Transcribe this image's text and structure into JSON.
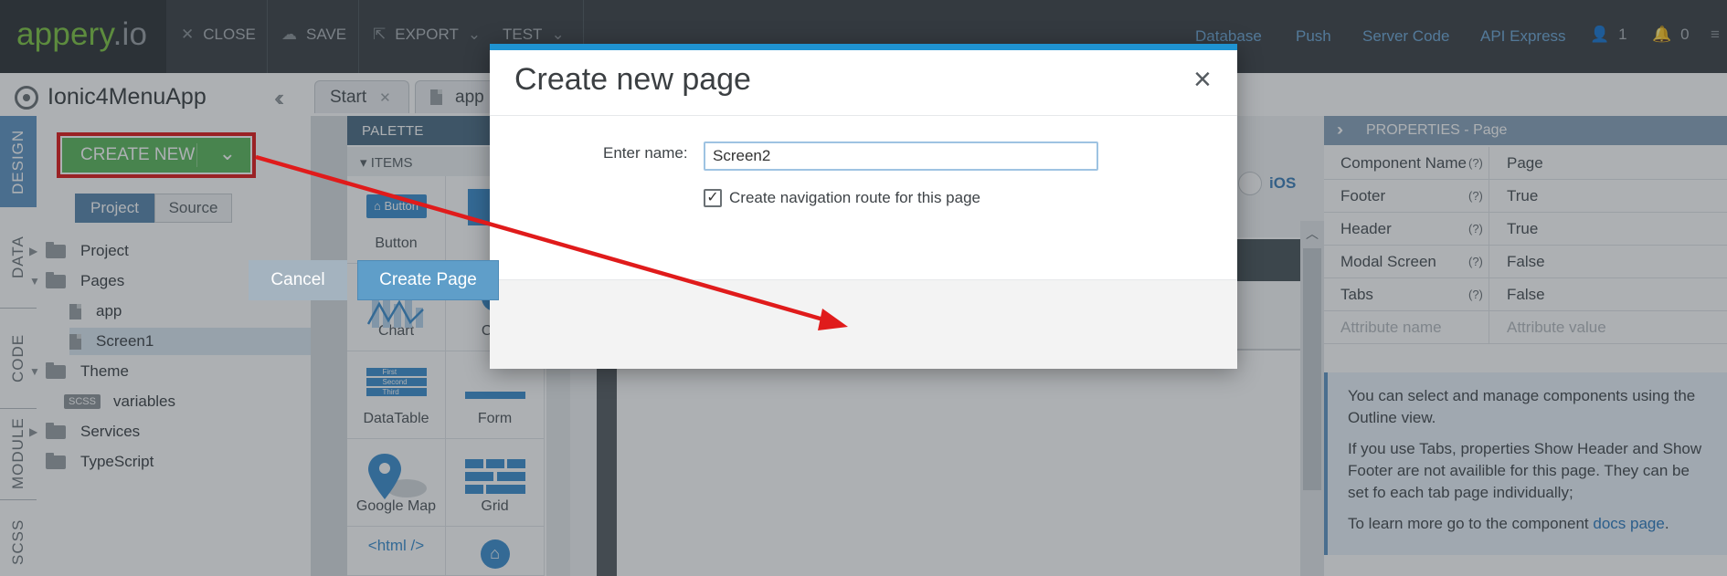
{
  "topbar": {
    "logo_main": "appery",
    "logo_suffix": ".io",
    "close_label": "CLOSE",
    "save_label": "SAVE",
    "export_label": "EXPORT",
    "test_label": "TEST",
    "database_label": "Database",
    "push_label": "Push",
    "server_code_label": "Server Code",
    "api_express_label": "API Express",
    "user_count": "1",
    "notification_count": "0"
  },
  "project": {
    "title": "Ionic4MenuApp",
    "create_new_label": "CREATE NEW",
    "view_project_label": "Project",
    "view_source_label": "Source",
    "tree": [
      {
        "label": "Project",
        "type": "folder",
        "expandable": true
      },
      {
        "label": "Pages",
        "type": "folder",
        "expanded": true
      },
      {
        "label": "app",
        "type": "file"
      },
      {
        "label": "Screen1",
        "type": "file",
        "selected": true
      },
      {
        "label": "Theme",
        "type": "folder",
        "expanded": true
      },
      {
        "label": "variables",
        "type": "scss",
        "badge": "SCSS"
      },
      {
        "label": "Services",
        "type": "folder",
        "expandable": true
      },
      {
        "label": "TypeScript",
        "type": "folder"
      }
    ]
  },
  "editor_tabs": [
    {
      "label": "Start"
    },
    {
      "label": "app"
    }
  ],
  "side_tabs": [
    "DESIGN",
    "DATA",
    "CODE",
    "MODULE",
    "SCSS"
  ],
  "palette": {
    "title": "PALETTE",
    "section": "ITEMS",
    "button_art_label": "Button",
    "items": [
      "Button",
      "C",
      "Chart",
      "Che",
      "DataTable",
      "Form",
      "Google Map",
      "Grid",
      "<html />",
      ""
    ],
    "datatable_art_rows": [
      "First",
      "Second",
      "Third"
    ]
  },
  "canvas": {
    "platform_label": "iOS"
  },
  "properties": {
    "title": "PROPERTIES - Page",
    "help_marker": "(?)",
    "rows": [
      {
        "name": "Component Name",
        "value": "Page"
      },
      {
        "name": "Footer",
        "value": "True"
      },
      {
        "name": "Header",
        "value": "True"
      },
      {
        "name": "Modal Screen",
        "value": "False"
      },
      {
        "name": "Tabs",
        "value": "False"
      }
    ],
    "attr_name_placeholder": "Attribute name",
    "attr_value_placeholder": "Attribute value",
    "help_line1": "You can select and manage components using the Outline view.",
    "help_line2": "If you use Tabs, properties Show Header and Show Footer are not availible for this page. They can be set fo each tab page individually;",
    "help_line3_prefix": "To learn more go to the component ",
    "help_link": "docs page",
    "help_line3_suffix": "."
  },
  "dialog": {
    "title": "Create new page",
    "close_glyph": "×",
    "name_label": "Enter name:",
    "name_value": "Screen2",
    "route_checkbox_checked": true,
    "route_label": "Create navigation route for this page",
    "cancel_label": "Cancel",
    "create_label": "Create Page"
  },
  "colors": {
    "accent_blue": "#1f93d1",
    "create_green": "#5cb85c",
    "annotation_red": "#e01b1b",
    "topbar": "#3c4246"
  }
}
